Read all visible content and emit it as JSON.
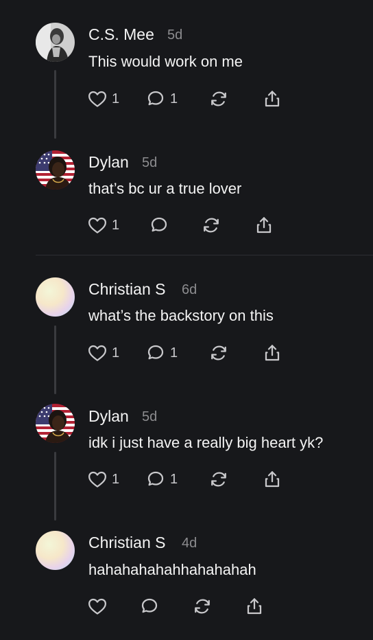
{
  "posts": [
    {
      "author": "C.S. Mee",
      "time": "5d",
      "text": "This would work on me",
      "likes": "1",
      "replies": "1",
      "avatar": "photo-person-dark"
    },
    {
      "author": "Dylan",
      "time": "5d",
      "text": "that’s bc ur a true lover",
      "likes": "1",
      "replies": "",
      "avatar": "photo-person-flag"
    },
    {
      "author": "Christian S",
      "time": "6d",
      "text": "what’s the backstory on this",
      "likes": "1",
      "replies": "1",
      "avatar": "gradient-pastel"
    },
    {
      "author": "Dylan",
      "time": "5d",
      "text": "idk i just have a really big heart yk?",
      "likes": "1",
      "replies": "1",
      "avatar": "photo-person-flag"
    },
    {
      "author": "Christian S",
      "time": "4d",
      "text": "hahahahahahhahahahah",
      "likes": "",
      "replies": "",
      "avatar": "gradient-pastel"
    }
  ],
  "icons": {
    "like": "heart-icon",
    "reply": "comment-icon",
    "repost": "repost-icon",
    "share": "share-icon"
  },
  "colors": {
    "background": "#17181b",
    "text": "#f4f4f4",
    "muted": "#8c8c8f",
    "icon": "#c9c9cc"
  }
}
